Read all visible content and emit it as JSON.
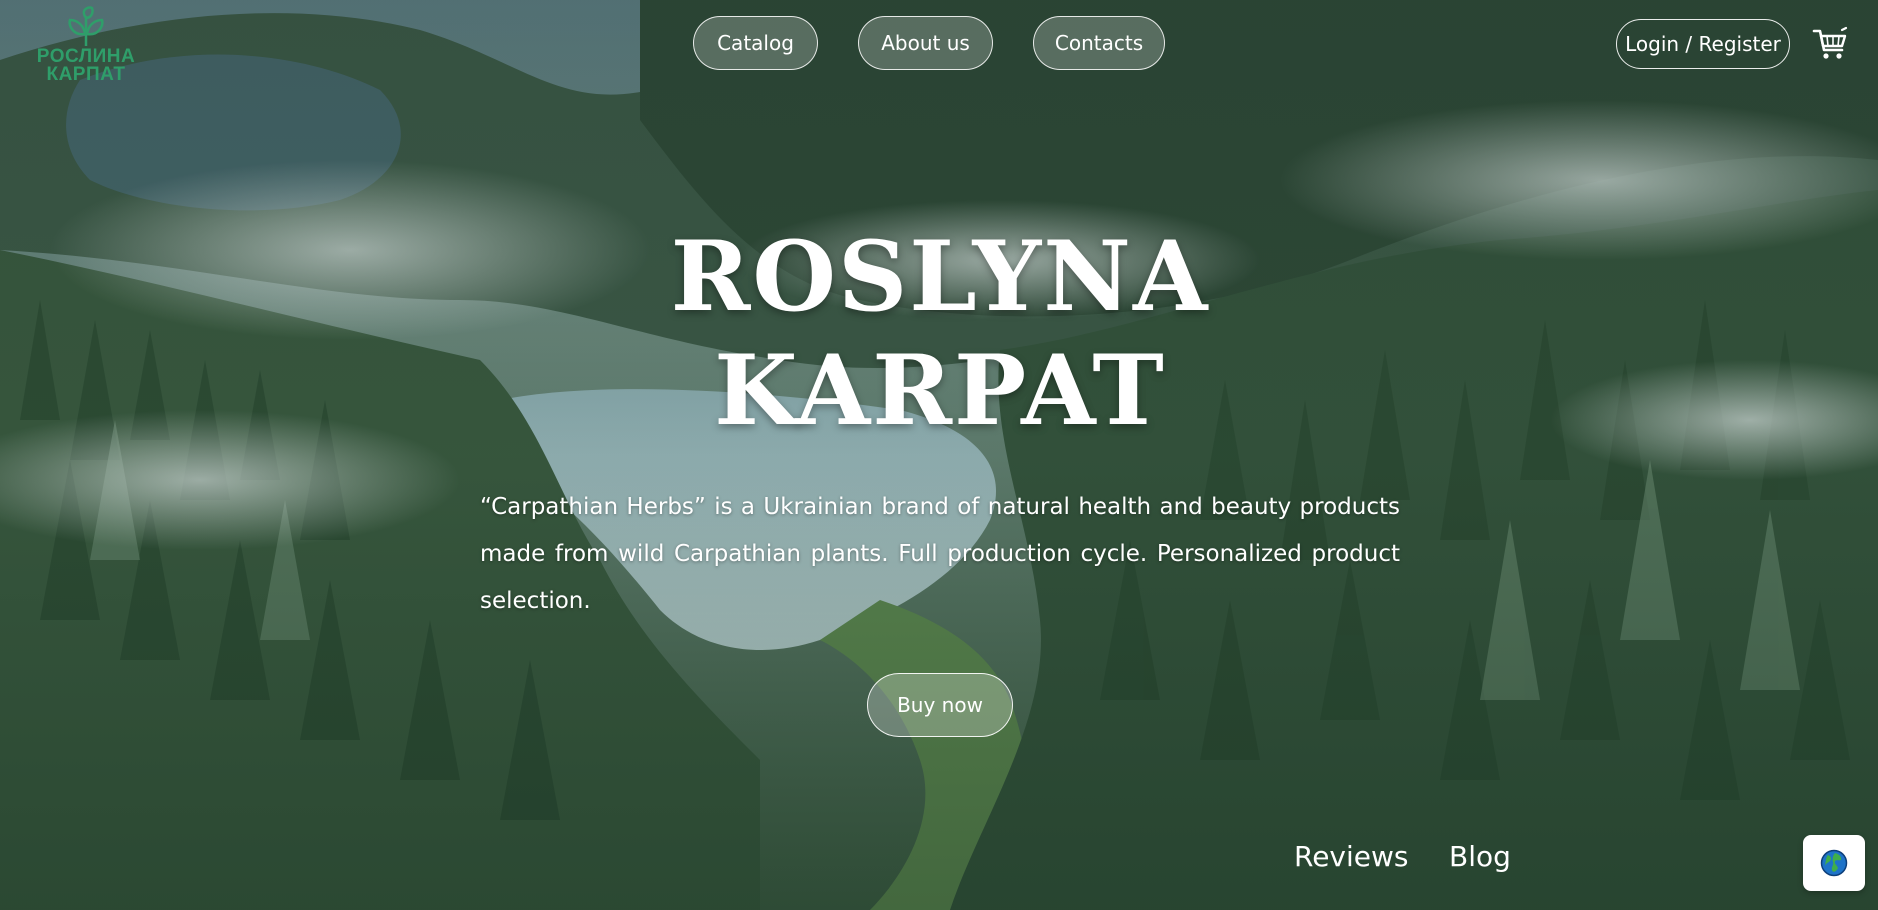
{
  "header": {
    "logo": {
      "line1": "РОСЛИНА",
      "line2": "КАРПАТ"
    },
    "nav": [
      {
        "label": "Catalog"
      },
      {
        "label": "About us"
      },
      {
        "label": "Contacts"
      }
    ],
    "login_label": "Login / Register",
    "cart_icon": "cart-icon"
  },
  "hero": {
    "title_line1": "ROSLYNA",
    "title_line2": "KARPAT",
    "description": "“Carpathian Herbs” is a Ukrainian brand of natural health and beauty products made from wild Carpathian plants. Full production cycle. Personalized product selection.",
    "cta_label": "Buy now"
  },
  "footer_links": [
    {
      "label": "Reviews"
    },
    {
      "label": "Blog"
    }
  ],
  "language_widget": {
    "icon": "globe-icon"
  },
  "colors": {
    "logo_green": "#2f9e6a",
    "forest_dark": "#2e4a36",
    "forest_mid": "#4f6f55",
    "text": "#ffffff"
  }
}
